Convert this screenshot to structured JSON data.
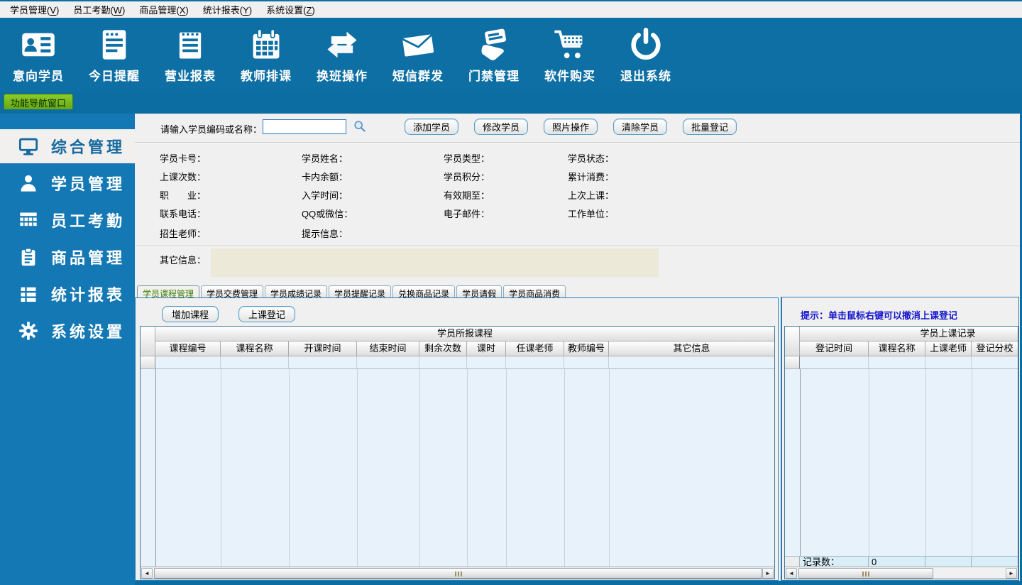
{
  "menubar": {
    "items": [
      {
        "text": "学员管理",
        "key": "V"
      },
      {
        "text": "员工考勤",
        "key": "W"
      },
      {
        "text": "商品管理",
        "key": "X"
      },
      {
        "text": "统计报表",
        "key": "Y"
      },
      {
        "text": "系统设置",
        "key": "Z"
      }
    ]
  },
  "toolbar": {
    "items": [
      {
        "label": "意向学员",
        "icon": "id-card-icon"
      },
      {
        "label": "今日提醒",
        "icon": "reminder-window-icon"
      },
      {
        "label": "营业报表",
        "icon": "notepad-icon"
      },
      {
        "label": "教师排课",
        "icon": "calendar-icon"
      },
      {
        "label": "换班操作",
        "icon": "swap-arrows-icon"
      },
      {
        "label": "短信群发",
        "icon": "envelope-icon"
      },
      {
        "label": "门禁管理",
        "icon": "access-card-icon"
      },
      {
        "label": "软件购买",
        "icon": "shopping-cart-icon"
      },
      {
        "label": "退出系统",
        "icon": "power-icon"
      }
    ]
  },
  "nav": {
    "window_tab": "功能导航窗口",
    "items": [
      {
        "label": "综合管理",
        "icon": "monitor-icon",
        "selected": true
      },
      {
        "label": "学员管理",
        "icon": "user-icon",
        "selected": false
      },
      {
        "label": "员工考勤",
        "icon": "attendance-grid-icon",
        "selected": false
      },
      {
        "label": "商品管理",
        "icon": "clipboard-icon",
        "selected": false
      },
      {
        "label": "统计报表",
        "icon": "report-list-icon",
        "selected": false
      },
      {
        "label": "系统设置",
        "icon": "gear-icon",
        "selected": false
      }
    ]
  },
  "search": {
    "label": "请输入学员编码或名称：",
    "value": "",
    "buttons": [
      "添加学员",
      "修改学员",
      "照片操作",
      "清除学员",
      "批量登记"
    ]
  },
  "info_fields": {
    "rows": [
      [
        "学员卡号：",
        "学员姓名：",
        "学员类型：",
        "学员状态："
      ],
      [
        "上课次数：",
        "卡内余额：",
        "学员积分：",
        "累计消费："
      ],
      [
        "职　　业：",
        "入学时间：",
        "有效期至：",
        "上次上课："
      ],
      [
        "联系电话：",
        "QQ或微信：",
        "电子邮件：",
        "工作单位："
      ],
      [
        "招生老师：",
        "提示信息："
      ]
    ],
    "other_info_label": "其它信息："
  },
  "tabs": {
    "selected": "学员课程管理",
    "items": [
      "学员课程管理",
      "学员交费管理",
      "学员成绩记录",
      "学员提醒记录",
      "兑换商品记录",
      "学员请假",
      "学员商品消费"
    ]
  },
  "course_panel": {
    "buttons": [
      "增加课程",
      "上课登记"
    ],
    "hint": "提示：单击鼠标右键可以撤消上课登记"
  },
  "main_table": {
    "group_title": "学员所报课程",
    "columns": [
      "课程编号",
      "课程名称",
      "开课时间",
      "结束时间",
      "剩余次数",
      "课时",
      "任课老师",
      "教师编号",
      "其它信息"
    ]
  },
  "right_table": {
    "group_title": "学员上课记录",
    "columns": [
      "登记时间",
      "课程名称",
      "上课老师",
      "登记分校"
    ],
    "record_count_label": "记录数：",
    "record_count_value": "0"
  },
  "colors": {
    "toolbar_blue": "#0E6FA4",
    "sidebar_blue": "#1478B4",
    "nav_tab_green": "#74BD1F",
    "hint_blue": "#1414CC",
    "selected_tab_green": "#3E7D0C",
    "table_body_blue": "#E8F2FA",
    "info_box_beige": "#ECE9D8"
  }
}
